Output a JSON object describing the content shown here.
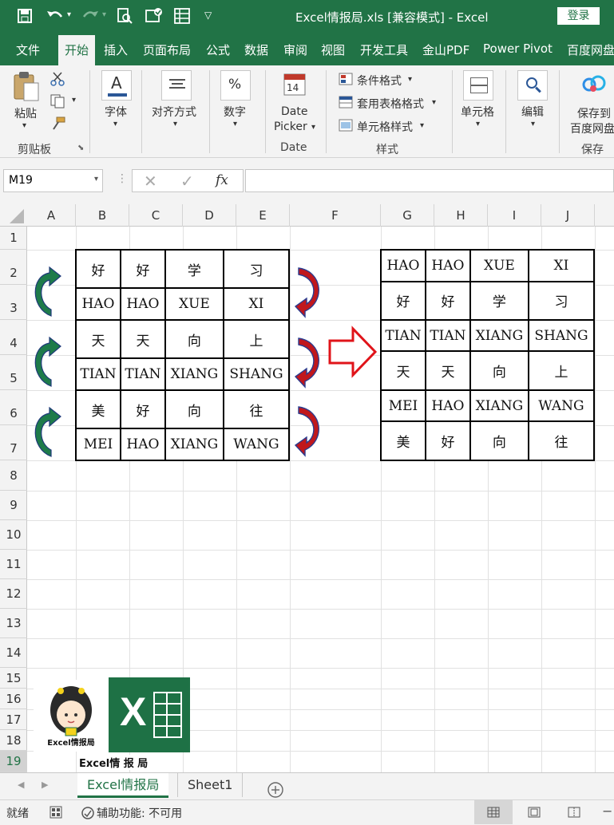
{
  "title_bar": {
    "title": "Excel情报局.xls [兼容模式] - Excel",
    "login_label": "登录"
  },
  "menu_tabs": [
    "文件",
    "开始",
    "插入",
    "页面布局",
    "公式",
    "数据",
    "审阅",
    "视图",
    "开发工具",
    "金山PDF",
    "Power Pivot",
    "百度网盘"
  ],
  "active_tab": "开始",
  "ribbon": {
    "paste_label": "粘贴",
    "clipboard_group": "剪贴板",
    "font_label": "字体",
    "align_label": "对齐方式",
    "number_label": "数字",
    "date_picker_line1": "Date",
    "date_picker_line2": "Picker",
    "date_group": "Date",
    "date_icon_number": "14",
    "conditional_format": "条件格式",
    "table_format": "套用表格格式",
    "cell_style": "单元格样式",
    "styles_group": "样式",
    "cells_label": "单元格",
    "edit_label": "编辑",
    "save_line1": "保存到",
    "save_line2": "百度网盘",
    "save_group": "保存"
  },
  "formula_bar": {
    "name_box": "M19",
    "fx_label": "fx"
  },
  "columns": [
    "A",
    "B",
    "C",
    "D",
    "E",
    "F",
    "G",
    "H",
    "I",
    "J"
  ],
  "rows": [
    "1",
    "2",
    "3",
    "4",
    "5",
    "6",
    "7",
    "8",
    "9",
    "10",
    "11",
    "12",
    "13",
    "14",
    "15",
    "16",
    "17",
    "18",
    "19"
  ],
  "selected_row": "19",
  "left_table": [
    [
      "好",
      "好",
      "学",
      "习"
    ],
    [
      "HAO",
      "HAO",
      "XUE",
      "XI"
    ],
    [
      "天",
      "天",
      "向",
      "上"
    ],
    [
      "TIAN",
      "TIAN",
      "XIANG",
      "SHANG"
    ],
    [
      "美",
      "好",
      "向",
      "往"
    ],
    [
      "MEI",
      "HAO",
      "XIANG",
      "WANG"
    ]
  ],
  "right_table": [
    [
      "HAO",
      "HAO",
      "XUE",
      "XI"
    ],
    [
      "好",
      "好",
      "学",
      "习"
    ],
    [
      "TIAN",
      "TIAN",
      "XIANG",
      "SHANG"
    ],
    [
      "天",
      "天",
      "向",
      "上"
    ],
    [
      "MEI",
      "HAO",
      "XIANG",
      "WANG"
    ],
    [
      "美",
      "好",
      "向",
      "往"
    ]
  ],
  "logo": {
    "badge_text": "Excel情报局",
    "caption": "Excel情 报 局",
    "excel_letter": "X"
  },
  "sheet_tabs": [
    "Excel情报局",
    "Sheet1"
  ],
  "active_sheet": "Excel情报局",
  "status_bar": {
    "ready": "就绪",
    "accessibility": "辅助功能: 不可用"
  },
  "colors": {
    "excel_green": "#217346",
    "arrow_green": "#1e7b4a",
    "arrow_red": "#c0171c",
    "arrow_blue_edge": "#2b3c8f"
  }
}
